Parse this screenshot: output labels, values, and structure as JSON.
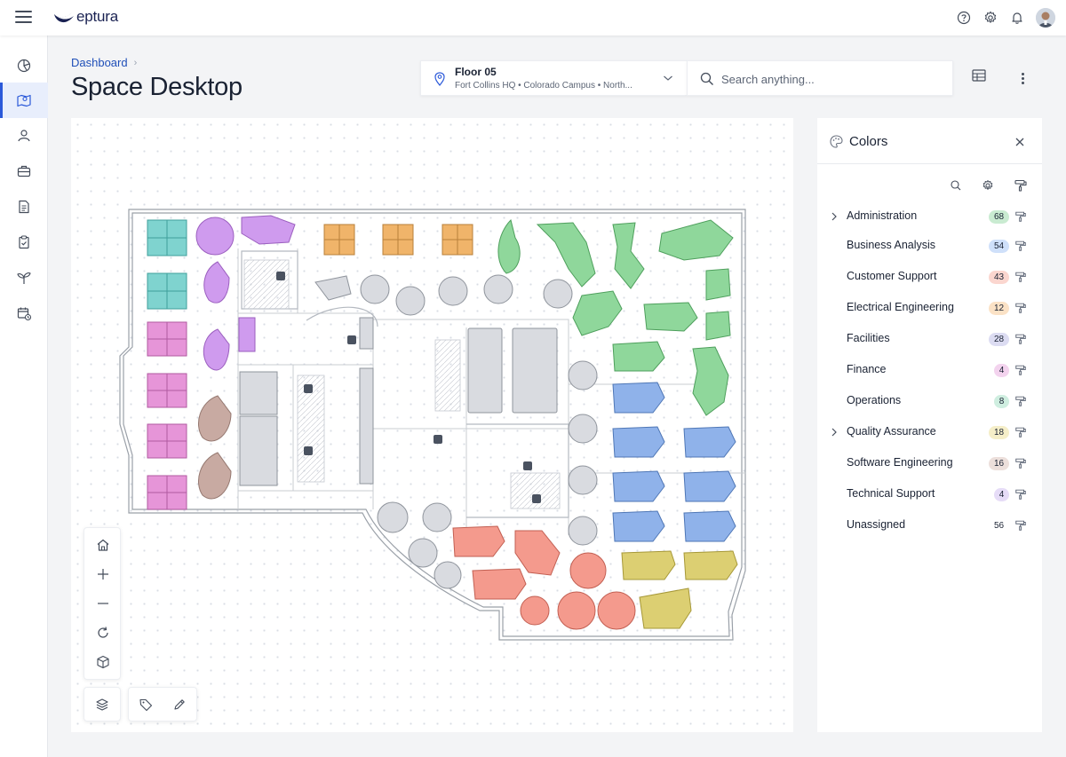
{
  "app": {
    "brand": "eptura"
  },
  "header": {
    "breadcrumb": {
      "label": "Dashboard"
    },
    "page_title": "Space Desktop",
    "floor": {
      "name": "Floor 05",
      "path": "Fort Collins HQ • Colorado Campus • North..."
    },
    "search": {
      "placeholder": "Search anything..."
    }
  },
  "nav": {
    "items": [
      {
        "name": "dashboard",
        "icon": "chart-icon",
        "active": false
      },
      {
        "name": "space",
        "icon": "map-icon",
        "active": true
      },
      {
        "name": "people",
        "icon": "person-icon",
        "active": false
      },
      {
        "name": "assets",
        "icon": "briefcase-icon",
        "active": false
      },
      {
        "name": "documents",
        "icon": "document-icon",
        "active": false
      },
      {
        "name": "tasks",
        "icon": "clipboard-icon",
        "active": false
      },
      {
        "name": "sustainability",
        "icon": "sprout-icon",
        "active": false
      },
      {
        "name": "reservations",
        "icon": "calendar-icon",
        "active": false
      }
    ]
  },
  "colors_panel": {
    "title": "Colors",
    "categories": [
      {
        "label": "Administration",
        "count": "68",
        "color": "#c9ebd1",
        "expandable": true
      },
      {
        "label": "Business Analysis",
        "count": "54",
        "color": "#cfe0fa",
        "expandable": false
      },
      {
        "label": "Customer Support",
        "count": "43",
        "color": "#fbd6cf",
        "expandable": false
      },
      {
        "label": "Electrical Engineering",
        "count": "12",
        "color": "#fbe2c6",
        "expandable": false
      },
      {
        "label": "Facilities",
        "count": "28",
        "color": "#dcdcf2",
        "expandable": false
      },
      {
        "label": "Finance",
        "count": "4",
        "color": "#f3d3ee",
        "expandable": false
      },
      {
        "label": "Operations",
        "count": "8",
        "color": "#cfeee0",
        "expandable": false
      },
      {
        "label": "Quality Assurance",
        "count": "18",
        "color": "#f5eec8",
        "expandable": true
      },
      {
        "label": "Software Engineering",
        "count": "16",
        "color": "#ecdfdb",
        "expandable": false
      },
      {
        "label": "Technical Support",
        "count": "4",
        "color": "#e6dcf7",
        "expandable": false
      },
      {
        "label": "Unassigned",
        "count": "56",
        "color": "#ffffff",
        "expandable": false
      }
    ]
  },
  "colors": {
    "accent": "#2b59d9",
    "teal": "#7fd3cf",
    "purple": "#cf9bee",
    "magenta": "#e695d8",
    "orange": "#f0b46a",
    "green": "#8fd79b",
    "blue": "#8fb2ea",
    "salmon": "#f49a8d",
    "yellow": "#dccf72",
    "brown": "#c8aaa2",
    "gray": "#d9dbe0"
  }
}
